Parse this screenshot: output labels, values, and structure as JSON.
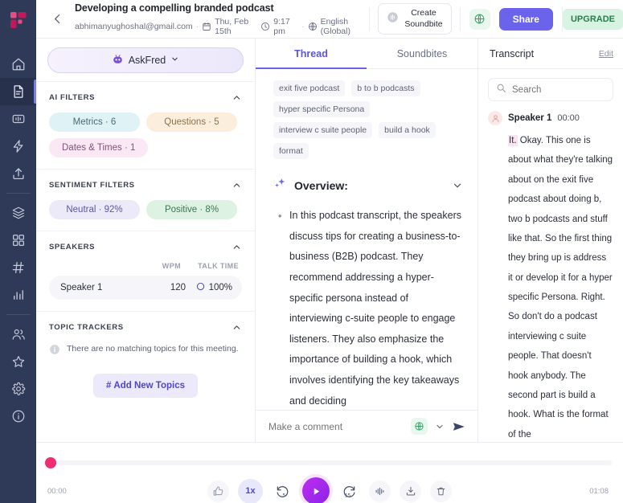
{
  "rail": {
    "logo_name": "fireflies-logo",
    "items": [
      {
        "name": "home-icon",
        "label": "Home",
        "active": false
      },
      {
        "name": "document-icon",
        "label": "Notes",
        "active": true
      },
      {
        "name": "soundbite-icon",
        "label": "Soundbites",
        "active": false
      },
      {
        "name": "lightning-icon",
        "label": "Automations",
        "active": false
      },
      {
        "name": "upload-icon",
        "label": "Upload",
        "active": false
      },
      {
        "name": "layers-icon",
        "label": "Channels",
        "active": false
      },
      {
        "name": "apps-grid-icon",
        "label": "Apps",
        "active": false
      },
      {
        "name": "hash-icon",
        "label": "Topics",
        "active": false
      },
      {
        "name": "bar-chart-icon",
        "label": "Analytics",
        "active": false
      },
      {
        "name": "people-icon",
        "label": "Team",
        "active": false
      },
      {
        "name": "star-icon",
        "label": "Favorites",
        "active": false
      },
      {
        "name": "gear-icon",
        "label": "Settings",
        "active": false
      },
      {
        "name": "info-icon",
        "label": "Help",
        "active": false
      }
    ]
  },
  "header": {
    "back_label": "Back",
    "title": "Developing a compelling branded podcast",
    "email": "abhimanyughoshal@gmail.com",
    "date": "Thu, Feb 15th",
    "time": "9:17 pm",
    "language": "English (Global)",
    "create_soundbite_line1": "Create",
    "create_soundbite_line2": "Soundbite",
    "share_label": "Share",
    "upgrade_label": "UPGRADE"
  },
  "sidebar": {
    "askfred_label": "AskFred",
    "ai_filters": {
      "title": "AI FILTERS",
      "chips": [
        {
          "label": "Metrics · 6",
          "cls": "metrics"
        },
        {
          "label": "Questions · 5",
          "cls": "questions"
        },
        {
          "label": "Dates & Times · 1",
          "cls": "dates"
        }
      ]
    },
    "sentiment_filters": {
      "title": "SENTIMENT FILTERS",
      "chips": [
        {
          "label": "Neutral · 92%",
          "cls": "neutral"
        },
        {
          "label": "Positive · 8%",
          "cls": "positive"
        }
      ]
    },
    "speakers": {
      "title": "SPEAKERS",
      "col_wpm": "WPM",
      "col_talk_time": "TALK TIME",
      "rows": [
        {
          "name": "Speaker 1",
          "wpm": "120",
          "talk_time": "100%"
        }
      ]
    },
    "topic_trackers": {
      "title": "TOPIC TRACKERS",
      "empty_text": "There are no matching topics for this meeting.",
      "add_button": "Add New Topics",
      "add_button_prefix": "#"
    }
  },
  "thread": {
    "tabs": [
      {
        "label": "Thread",
        "active": true
      },
      {
        "label": "Soundbites",
        "active": false
      }
    ],
    "keywords": [
      "exit five podcast",
      "b to b podcasts",
      "hyper specific Persona",
      "interview c suite people",
      "build a hook",
      "format"
    ],
    "overview_title": "Overview:",
    "overview_bullets": [
      "In this podcast transcript, the speakers discuss tips for creating a business-to-business (B2B) podcast. They recommend addressing a hyper-specific persona instead of interviewing c-suite people to engage listeners. They also emphasize the importance of building a hook, which involves identifying the key takeaways and deciding"
    ],
    "comment_placeholder": "Make a comment"
  },
  "transcript": {
    "title": "Transcript",
    "edit_label": "Edit",
    "search_placeholder": "Search",
    "entries": [
      {
        "speaker": "Speaker 1",
        "time": "00:00",
        "highlight": "It.",
        "text": " Okay. This one is about what they're talking about on the exit five podcast about doing b, two b podcasts and stuff like that. So the first thing they bring up is address it or develop it for a hyper specific Persona. Right. So don't do a podcast interviewing c suite people. That doesn't hook anybody. The second part is build a hook. What is the format of the"
      }
    ]
  },
  "player": {
    "current_time": "00:00",
    "total_time": "01:08",
    "speed_label": "1x",
    "progress_percent": 0,
    "controls": [
      {
        "name": "thumbs-up-icon",
        "label": "Like"
      },
      {
        "name": "playback-speed-button",
        "label": "1x"
      },
      {
        "name": "rewind-5-icon",
        "label": "Rewind 5s"
      },
      {
        "name": "play-icon",
        "label": "Play"
      },
      {
        "name": "forward-15-icon",
        "label": "Forward 15s"
      },
      {
        "name": "waveform-icon",
        "label": "Waveform"
      },
      {
        "name": "download-icon",
        "label": "Download"
      },
      {
        "name": "trash-icon",
        "label": "Delete"
      }
    ]
  },
  "colors": {
    "rail_bg": "#2f3a59",
    "accent": "#6c63ec",
    "play_button": "#b02dee",
    "progress_knob": "#ef2d73",
    "upgrade_bg": "#d8f3e1"
  }
}
